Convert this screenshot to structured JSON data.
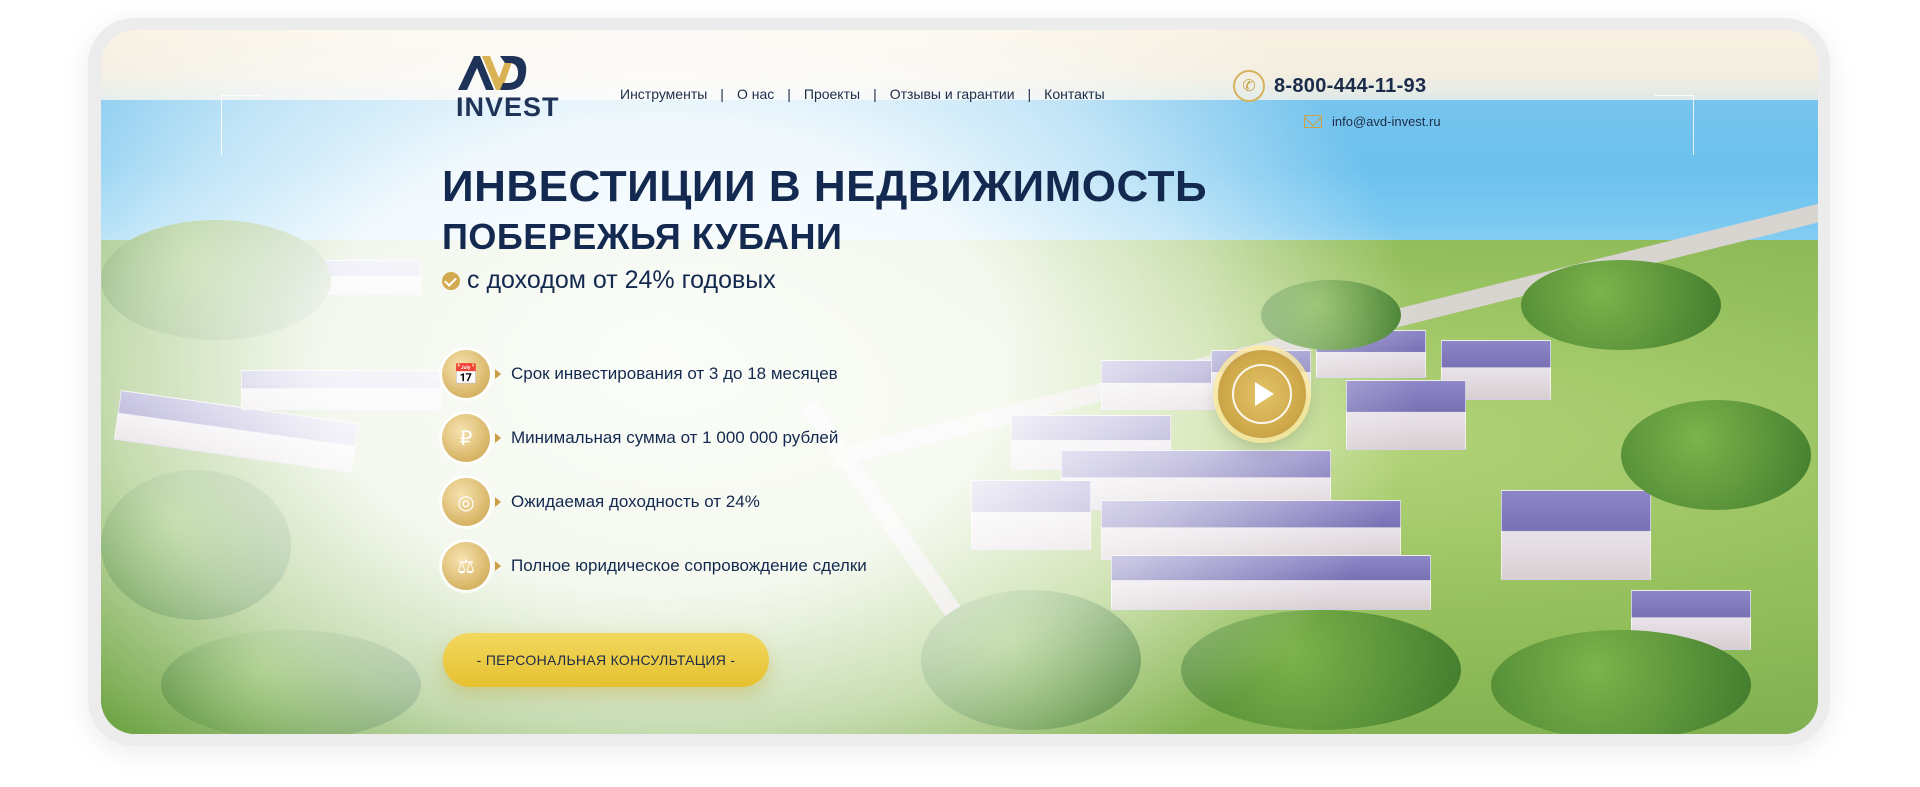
{
  "brand": {
    "logo_mark": "AVD",
    "logo_text": "INVEST"
  },
  "nav": {
    "items": [
      "Инструменты",
      "О нас",
      "Проекты",
      "Отзывы и гарантии",
      "Контакты"
    ],
    "separator": "|"
  },
  "contacts": {
    "phone": "8-800-444-11-93",
    "email": "info@avd-invest.ru",
    "phone_icon": "phone-icon",
    "email_icon": "envelope-icon"
  },
  "hero": {
    "title_line1": "ИНВЕСТИЦИИ В НЕДВИЖИМОСТЬ",
    "title_line2": "ПОБЕРЕЖЬЯ КУБАНИ",
    "subtitle": "с доходом от 24% годовых",
    "features": [
      {
        "icon": "calendar-icon",
        "text": "Срок инвестирования от 3 до 18 месяцев"
      },
      {
        "icon": "money-hand-icon",
        "text": "Минимальная сумма от 1 000 000 рублей"
      },
      {
        "icon": "coins-icon",
        "text": "Ожидаемая доходность от 24%"
      },
      {
        "icon": "scales-icon",
        "text": "Полное юридическое сопровождение сделки"
      }
    ],
    "cta_label": "- ПЕРСОНАЛЬНАЯ КОНСУЛЬТАЦИЯ -"
  },
  "colors": {
    "accent_gold": "#d2ab50",
    "button_yellow": "#e6c12f",
    "text_navy": "#14294f"
  }
}
